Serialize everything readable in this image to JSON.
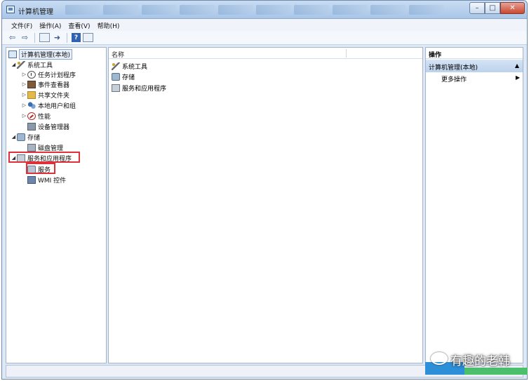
{
  "window": {
    "title": "计算机管理"
  },
  "menu": [
    "文件(F)",
    "操作(A)",
    "查看(V)",
    "帮助(H)"
  ],
  "tree": {
    "root": "计算机管理(本地)",
    "system_tools": "系统工具",
    "task_scheduler": "任务计划程序",
    "event_viewer": "事件查看器",
    "shared_folders": "共享文件夹",
    "local_users": "本地用户和组",
    "performance": "性能",
    "device_manager": "设备管理器",
    "storage": "存储",
    "disk_management": "磁盘管理",
    "services_apps": "服务和应用程序",
    "services": "服务",
    "wmi": "WMI 控件"
  },
  "center": {
    "column_name": "名称",
    "items": [
      "系统工具",
      "存储",
      "服务和应用程序"
    ]
  },
  "actions": {
    "header": "操作",
    "section": "计算机管理(本地)",
    "more": "更多操作"
  },
  "watermark": {
    "text": "有趣的老韩"
  },
  "colors": {
    "highlight_box": "#e0303a",
    "section_bg": "#c8dbf0"
  },
  "icons": [
    "computer-icon",
    "tools-icon",
    "clock-icon",
    "event-icon",
    "folder-icon",
    "users-icon",
    "performance-icon",
    "device-icon",
    "storage-icon",
    "disk-icon",
    "services-icon",
    "gear-icon",
    "wmi-icon"
  ]
}
